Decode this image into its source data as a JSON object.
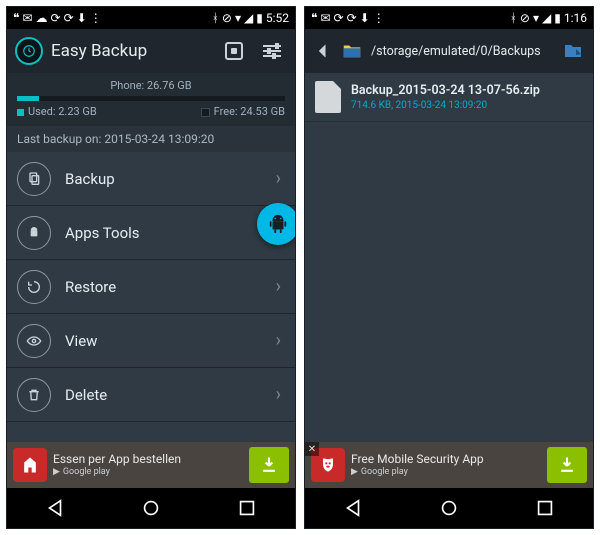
{
  "left": {
    "status": {
      "time": "5:52"
    },
    "appTitle": "Easy Backup",
    "capacity": {
      "totalLabel": "Phone: 26.76 GB",
      "usedLabel": "Used: 2.23 GB",
      "freeLabel": "Free: 24.53 GB",
      "usedPercent": 8.3
    },
    "lastBackup": "Last backup on: 2015-03-24 13:09:20",
    "menu": [
      {
        "label": "Backup"
      },
      {
        "label": "Apps Tools"
      },
      {
        "label": "Restore"
      },
      {
        "label": "View"
      },
      {
        "label": "Delete"
      }
    ],
    "ad": {
      "title": "Essen per App bestellen",
      "store": "Google play"
    }
  },
  "right": {
    "status": {
      "time": "1:16"
    },
    "path": "/storage/emulated/0/Backups",
    "file": {
      "name": "Backup_2015-03-24 13-07-56.zip",
      "meta": "714.6 KB, 2015-03-24 13:09:20"
    },
    "ad": {
      "title": "Free Mobile Security App",
      "store": "Google play"
    }
  }
}
